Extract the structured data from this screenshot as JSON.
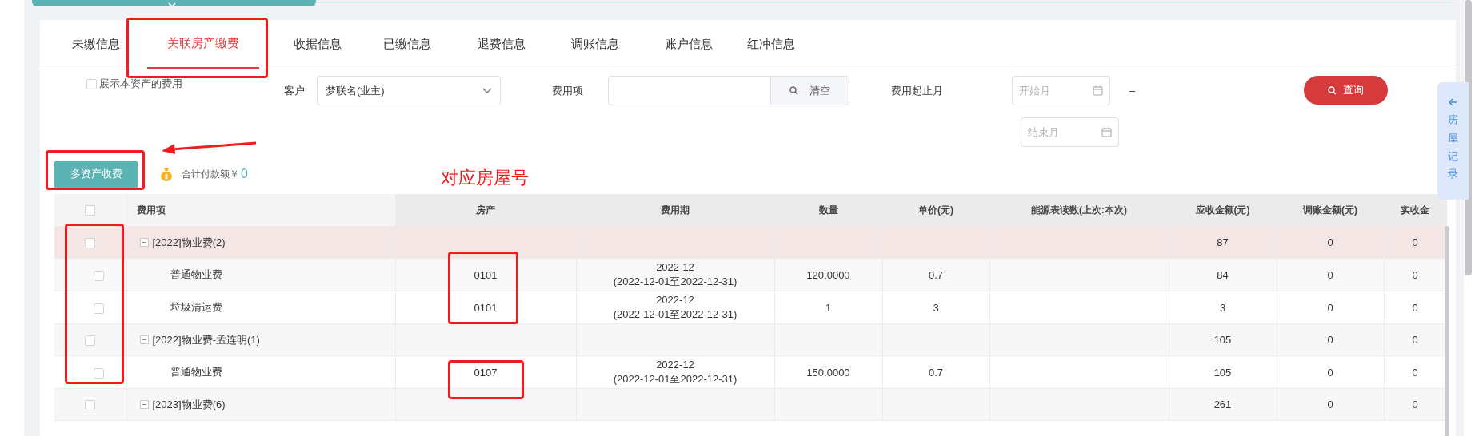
{
  "tabs": [
    {
      "label": "未缴信息",
      "selected": false
    },
    {
      "label": "关联房产缴费",
      "selected": true
    },
    {
      "label": "收据信息",
      "selected": false
    },
    {
      "label": "已缴信息",
      "selected": false
    },
    {
      "label": "退费信息",
      "selected": false
    },
    {
      "label": "调账信息",
      "selected": false
    },
    {
      "label": "账户信息",
      "selected": false
    },
    {
      "label": "红冲信息",
      "selected": false
    }
  ],
  "filters": {
    "show_asset_fees": {
      "label": "展示本资产的费用",
      "checked": false
    },
    "customer": {
      "label": "客户",
      "value": "梦联名(业主)"
    },
    "fee_item": {
      "label": "费用项",
      "clear_button": "清空"
    },
    "period": {
      "label": "费用起止月",
      "start_placeholder": "开始月",
      "separator": "–",
      "end_placeholder": "结束月"
    },
    "query_button": "查询"
  },
  "multi_asset_button": "多资产收费",
  "total": {
    "label": "合计付款额￥",
    "amount": "0"
  },
  "table": {
    "select_all_checked": false,
    "columns": [
      "费用项",
      "房产",
      "费用期",
      "数量",
      "单价(元)",
      "能源表读数(上次:本次)",
      "应收金额(元)",
      "调账金额(元)",
      "实收金"
    ],
    "rows": [
      {
        "kind": "group",
        "checked": false,
        "expanded": true,
        "highlighted": true,
        "fee_item": "[2022]物业费(2)",
        "receivable": "87",
        "adjusted": "0",
        "received": "0"
      },
      {
        "kind": "item",
        "checked": false,
        "highlighted": false,
        "fee_item": "普通物业费",
        "house": "0101",
        "period": "2022-12",
        "period_range": "(2022-12-01至2022-12-31)",
        "quantity": "120.0000",
        "unit_price": "0.7",
        "receivable": "84",
        "adjusted": "0",
        "received": "0"
      },
      {
        "kind": "item",
        "checked": false,
        "highlighted": false,
        "fee_item": "垃圾清运费",
        "house": "0101",
        "period": "2022-12",
        "period_range": "(2022-12-01至2022-12-31)",
        "quantity": "1",
        "unit_price": "3",
        "receivable": "3",
        "adjusted": "0",
        "received": "0"
      },
      {
        "kind": "group",
        "checked": false,
        "expanded": true,
        "highlighted": false,
        "fee_item": "[2022]物业费-孟连明(1)",
        "receivable": "105",
        "adjusted": "0",
        "received": "0"
      },
      {
        "kind": "item",
        "checked": false,
        "highlighted": false,
        "fee_item": "普通物业费",
        "house": "0107",
        "period": "2022-12",
        "period_range": "(2022-12-01至2022-12-31)",
        "quantity": "150.0000",
        "unit_price": "0.7",
        "receivable": "105",
        "adjusted": "0",
        "received": "0"
      },
      {
        "kind": "group",
        "checked": false,
        "expanded": true,
        "highlighted": false,
        "fee_item": "[2023]物业费(6)",
        "receivable": "261",
        "adjusted": "0",
        "received": "0"
      }
    ]
  },
  "side_panel": {
    "label": "房屋记录"
  },
  "annotation": {
    "note": "对应房屋号"
  }
}
